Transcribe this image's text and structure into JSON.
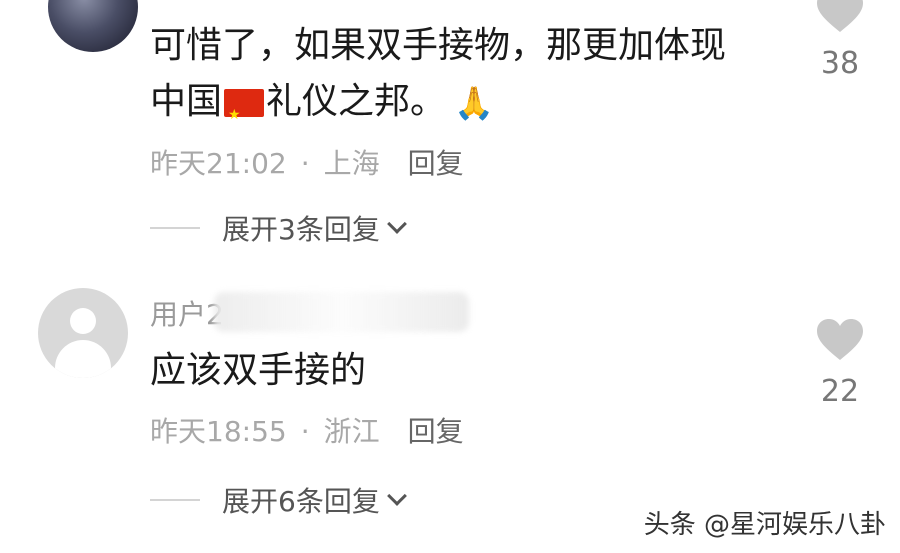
{
  "comments": [
    {
      "text_line1": "可惜了，如果双手接物，那更加体现",
      "text_line2_pre": "中国",
      "text_line2_post": "礼仪之邦。",
      "time": "昨天21:02",
      "location": "上海",
      "reply_label": "回复",
      "expand_label": "展开3条回复",
      "like_count": "38"
    },
    {
      "username": "用户2",
      "text": "应该双手接的",
      "time": "昨天18:55",
      "location": "浙江",
      "reply_label": "回复",
      "expand_label": "展开6条回复",
      "like_count": "22"
    }
  ],
  "icons": {
    "like": "heart-icon",
    "flag": "china-flag-emoji",
    "pray": "folded-hands-emoji",
    "expand": "chevron-down-icon"
  },
  "colors": {
    "like_heart": "#c8c8c8",
    "meta_text": "#a8a8a8",
    "flag_red": "#de2910"
  },
  "watermark": "头条 @星河娱乐八卦"
}
